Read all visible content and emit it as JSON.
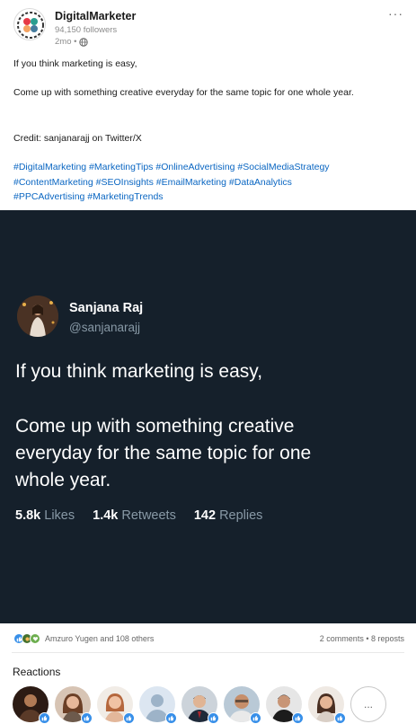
{
  "post": {
    "author": "DigitalMarketer",
    "followers": "94,150 followers",
    "age": "2mo •",
    "more_label": "···",
    "text_line1": "If you think marketing is easy,",
    "text_line2": "Come up with something creative everyday for the same topic for one whole year.",
    "credit": "Credit: sanjanarajj on Twitter/X",
    "hashtags": [
      "#DigitalMarketing",
      "#MarketingTips",
      "#OnlineAdvertising",
      "#SocialMediaStrategy",
      "#ContentMarketing",
      "#SEOInsights",
      "#EmailMarketing",
      "#DataAnalytics",
      "#PPCAdvertising",
      "#MarketingTrends"
    ]
  },
  "tweet": {
    "name": "Sanjana Raj",
    "handle": "@sanjanarajj",
    "line1": "If you think marketing is easy,",
    "line2": "Come up with something creative",
    "line3": "everyday for the same topic for one",
    "line4": "whole year.",
    "likes_count": "5.8k",
    "likes_label": "Likes",
    "retweets_count": "1.4k",
    "retweets_label": "Retweets",
    "replies_count": "142",
    "replies_label": "Replies"
  },
  "social": {
    "reactors_text": "Amzuro Yugen and 108 others",
    "counts_text": "2 comments • 8 reposts"
  },
  "reactions": {
    "heading": "Reactions",
    "more_label": "..."
  },
  "colors": {
    "link": "#0a66c2",
    "tweet_bg": "#15202b",
    "like_blue": "#378fe9"
  }
}
